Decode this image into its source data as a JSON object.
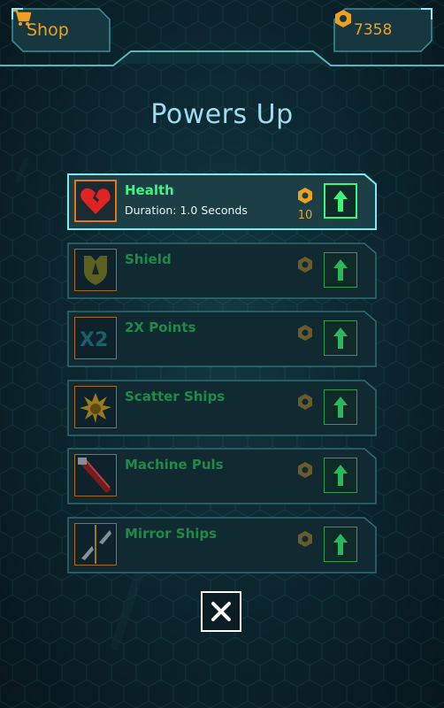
{
  "header": {
    "shop_label": "Shop",
    "coins": "7358"
  },
  "title": "Powers Up",
  "powers": [
    {
      "name": "Health",
      "description": "Duration: 1.0 Seconds",
      "cost": "10",
      "active": true,
      "icon": "broken-heart-icon"
    },
    {
      "name": "Shield",
      "description": "",
      "cost": "",
      "active": false,
      "icon": "shield-icon"
    },
    {
      "name": "2X Points",
      "description": "",
      "cost": "",
      "active": false,
      "icon": "x2-icon"
    },
    {
      "name": "Scatter Ships",
      "description": "",
      "cost": "",
      "active": false,
      "icon": "explosion-icon"
    },
    {
      "name": "Machine Puls",
      "description": "",
      "cost": "",
      "active": false,
      "icon": "laser-icon"
    },
    {
      "name": "Mirror Ships",
      "description": "",
      "cost": "",
      "active": false,
      "icon": "mirror-ships-icon"
    }
  ],
  "colors": {
    "accent_orange": "#f0a020",
    "active_green": "#3cf57a",
    "inactive_green": "#1f8a48",
    "title_cyan": "#9fdcf0",
    "frame_teal": "#2f6c72"
  }
}
